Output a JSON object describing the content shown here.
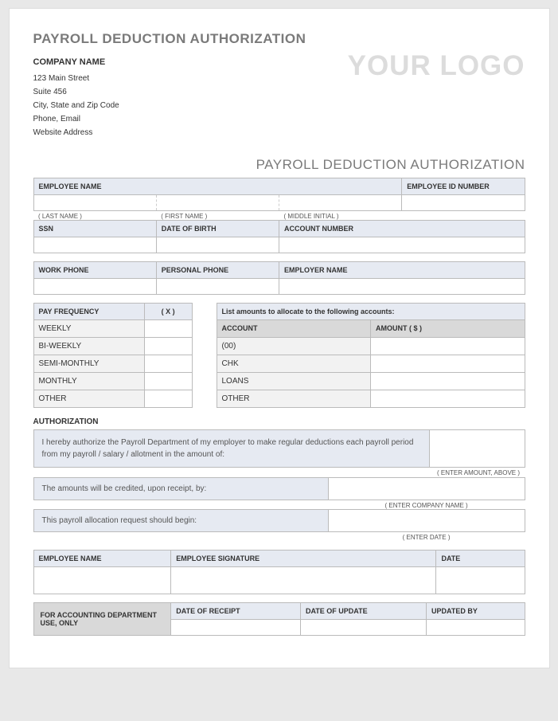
{
  "title": "PAYROLL DEDUCTION AUTHORIZATION",
  "company": {
    "name": "COMPANY NAME",
    "line1": "123 Main Street",
    "line2": "Suite 456",
    "line3": "City, State and Zip Code",
    "line4": "Phone, Email",
    "line5": "Website Address"
  },
  "logo": "YOUR LOGO",
  "subtitle": "PAYROLL DEDUCTION AUTHORIZATION",
  "headers": {
    "employee_name": "EMPLOYEE NAME",
    "employee_id": "EMPLOYEE ID NUMBER",
    "last_name": "( LAST NAME )",
    "first_name": "( FIRST NAME )",
    "middle_initial": "( MIDDLE INITIAL )",
    "ssn": "SSN",
    "dob": "DATE OF BIRTH",
    "account_number": "ACCOUNT NUMBER",
    "work_phone": "WORK PHONE",
    "personal_phone": "PERSONAL PHONE",
    "employer_name": "EMPLOYER NAME",
    "pay_frequency": "PAY FREQUENCY",
    "x": "( X )",
    "alloc_title": "List amounts to allocate to the following accounts:",
    "account": "ACCOUNT",
    "amount": "AMOUNT ( $ )",
    "employee_signature": "EMPLOYEE SIGNATURE",
    "date": "DATE",
    "for_accounting": "FOR ACCOUNTING DEPARTMENT USE, ONLY",
    "date_receipt": "DATE OF RECEIPT",
    "date_update": "DATE OF UPDATE",
    "updated_by": "UPDATED BY"
  },
  "freq": [
    "WEEKLY",
    "BI-WEEKLY",
    "SEMI-MONTHLY",
    "MONTHLY",
    "OTHER"
  ],
  "accounts": [
    "(00)",
    "CHK",
    "LOANS",
    "OTHER"
  ],
  "authorization": {
    "heading": "AUTHORIZATION",
    "text": "I hereby authorize the Payroll Department of my employer to make regular deductions each payroll period from my payroll / salary / allotment in the amount of:",
    "hint_amount": "( ENTER AMOUNT, ABOVE )",
    "credit_text": "The amounts will be credited, upon receipt, by:",
    "hint_company": "( ENTER COMPANY NAME )",
    "begin_text": "This payroll allocation request should begin:",
    "hint_date": "( ENTER DATE )"
  }
}
